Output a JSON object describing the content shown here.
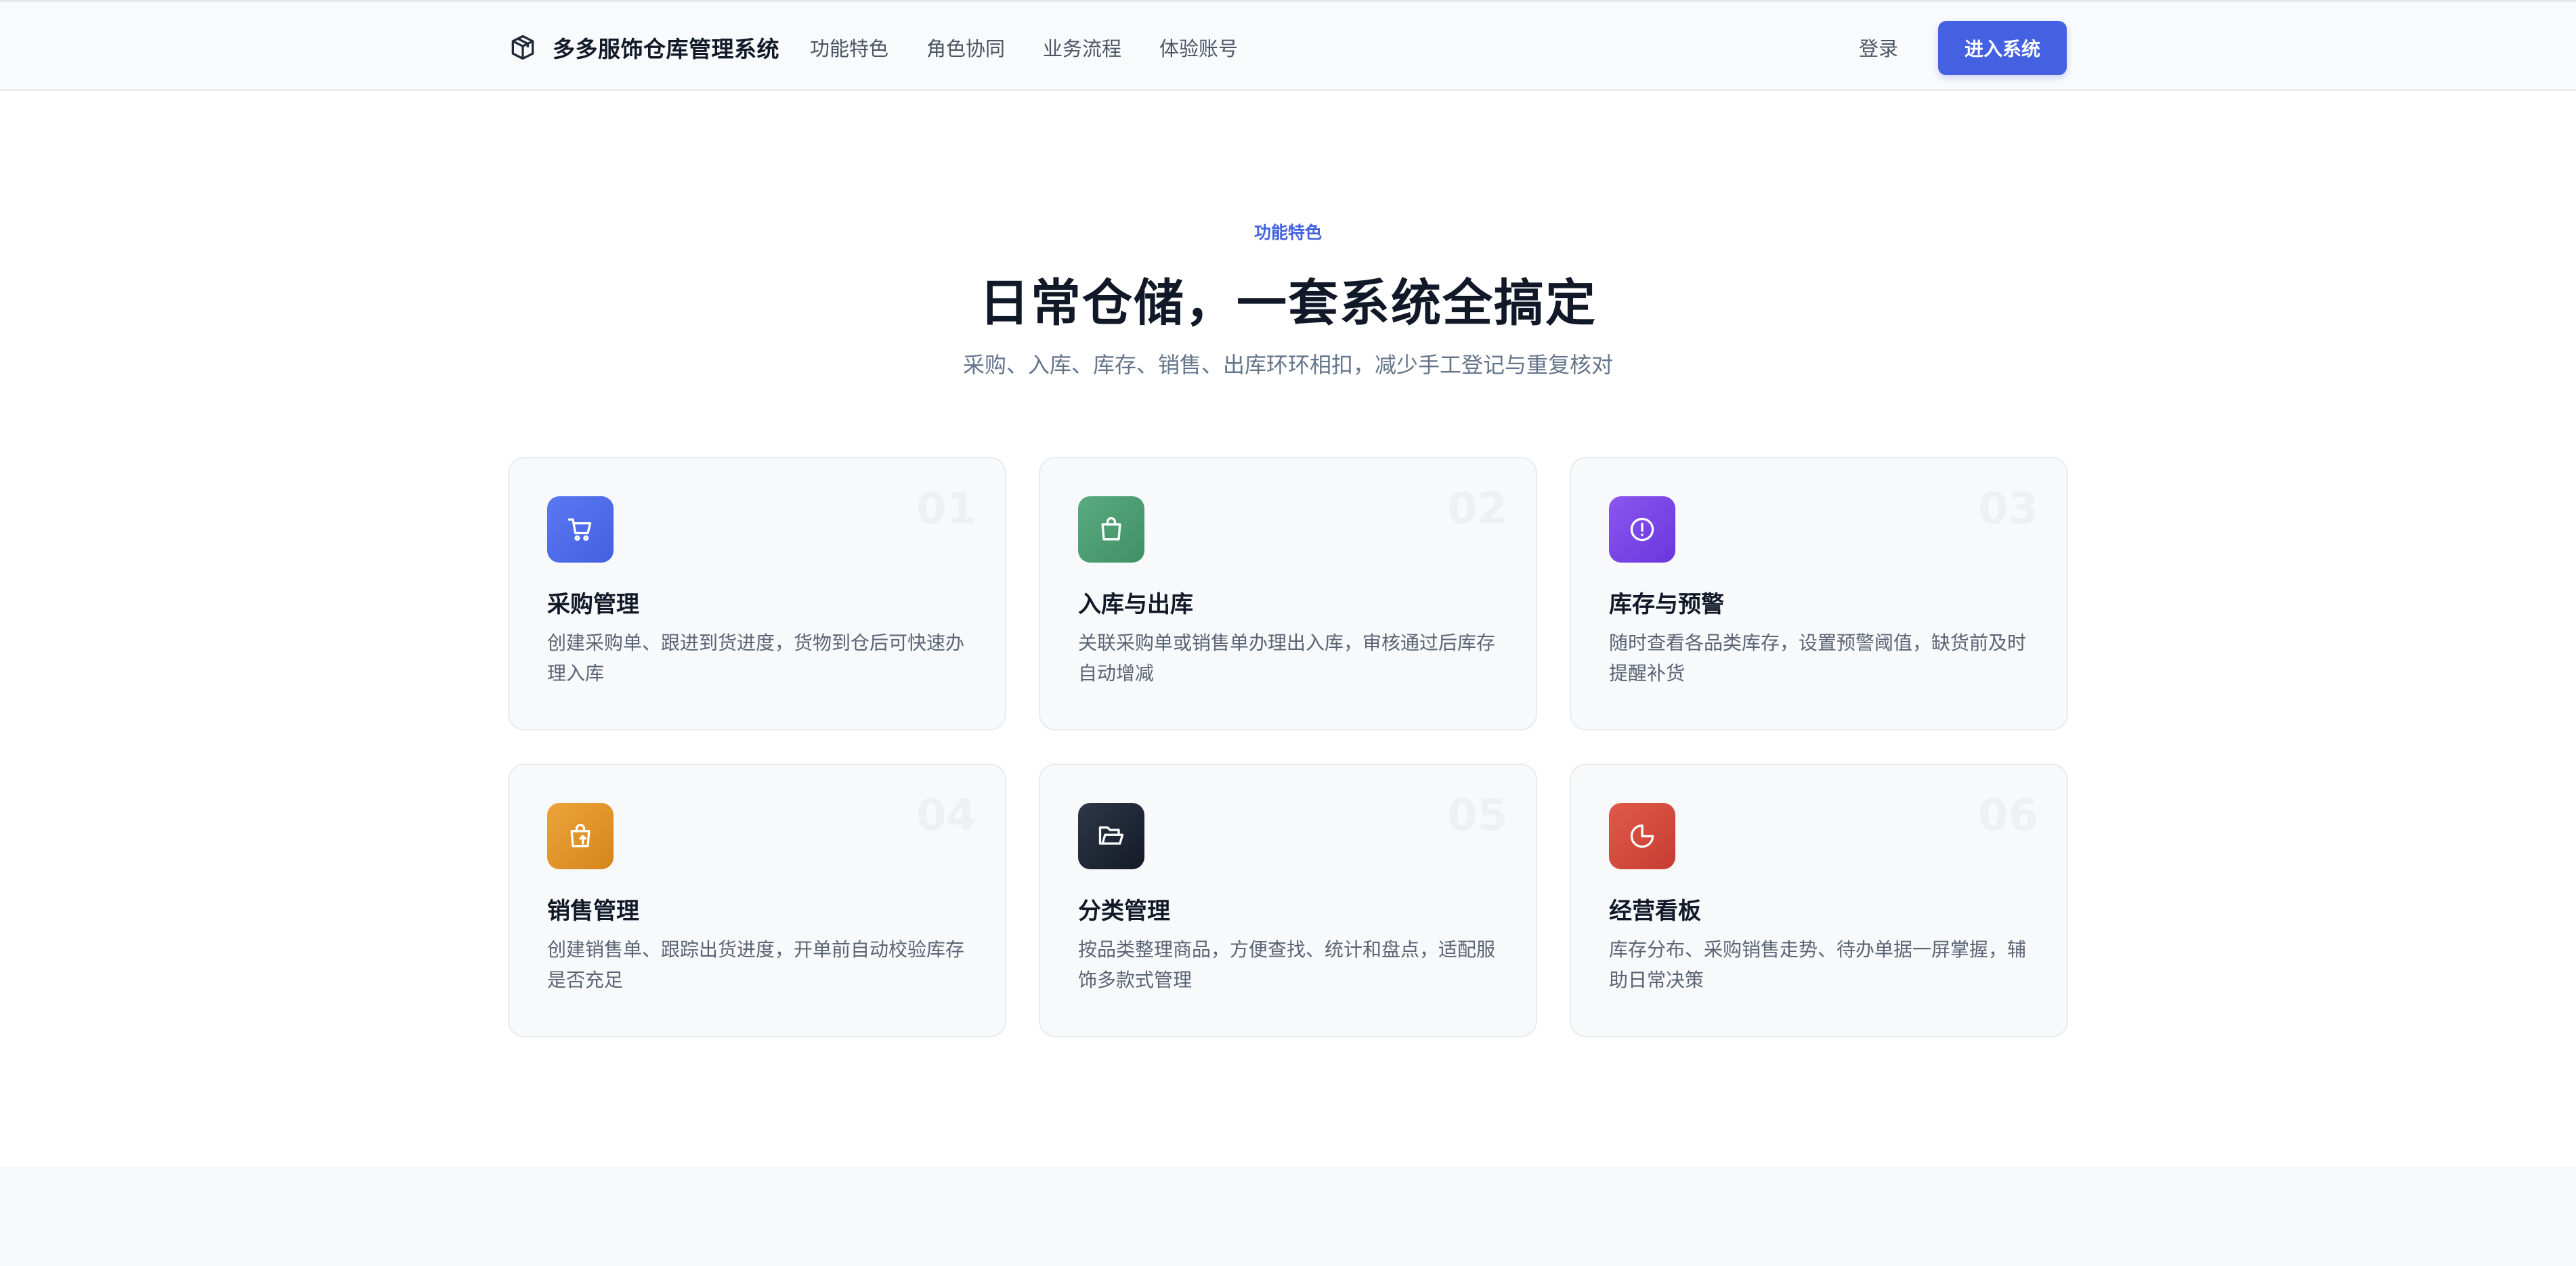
{
  "header": {
    "brand_name": "多多服饰仓库管理系统",
    "nav": [
      "功能特色",
      "角色协同",
      "业务流程",
      "体验账号"
    ],
    "login_label": "登录",
    "enter_label": "进入系统"
  },
  "section": {
    "eyebrow": "功能特色",
    "title": "日常仓储，一套系统全搞定",
    "subtitle": "采购、入库、库存、销售、出库环环相扣，减少手工登记与重复核对"
  },
  "features": [
    {
      "num": "01",
      "title": "采购管理",
      "desc": "创建采购单、跟进到货进度，货物到仓后可快速办理入库",
      "icon": "cart-icon",
      "color": "#4f6ef0"
    },
    {
      "num": "02",
      "title": "入库与出库",
      "desc": "关联采购单或销售单办理出入库，审核通过后库存自动增减",
      "icon": "bag-icon",
      "color": "#4e9e73"
    },
    {
      "num": "03",
      "title": "库存与预警",
      "desc": "随时查看各品类库存，设置预警阈值，缺货前及时提醒补货",
      "icon": "alert-icon",
      "color": "#7b48e8"
    },
    {
      "num": "04",
      "title": "销售管理",
      "desc": "创建销售单、跟踪出货进度，开单前自动校验库存是否充足",
      "icon": "shopping-bag-up-icon",
      "color": "#e0962a"
    },
    {
      "num": "05",
      "title": "分类管理",
      "desc": "按品类整理商品，方便查找、统计和盘点，适配服饰多款式管理",
      "icon": "folder-icon",
      "color": "#1f2937"
    },
    {
      "num": "06",
      "title": "经营看板",
      "desc": "库存分布、采购销售走势、待办单据一屏掌握，辅助日常决策",
      "icon": "pie-chart-icon",
      "color": "#d44d3f"
    }
  ]
}
